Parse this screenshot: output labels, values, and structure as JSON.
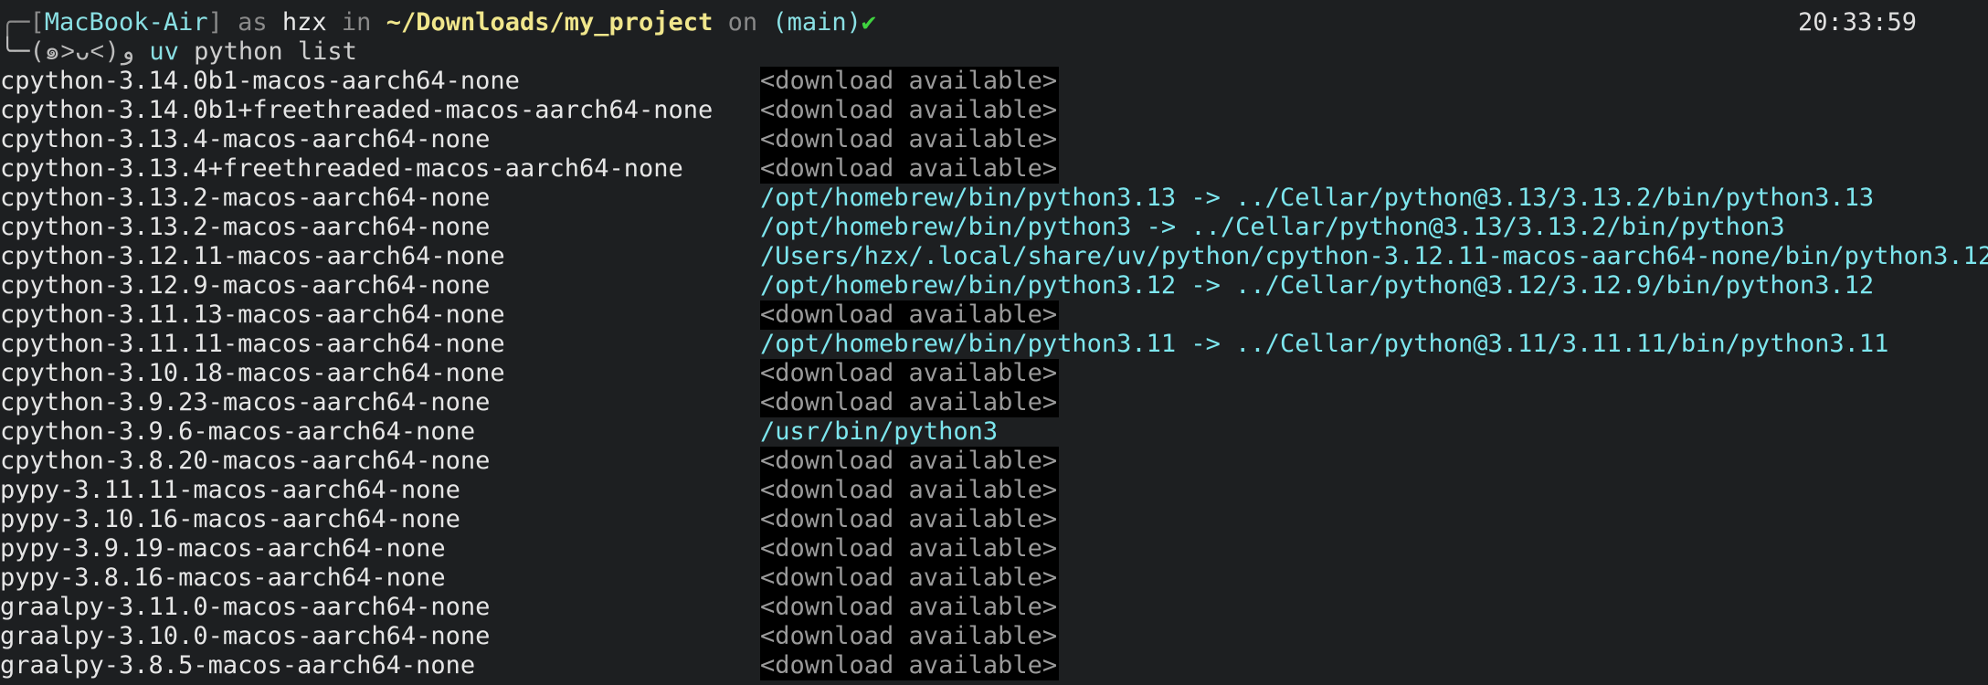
{
  "prompt": {
    "open_bracket": "╭─[",
    "host": "MacBook-Air",
    "close_bracket": "]",
    "as_word": " as ",
    "user": "hzx",
    "in_word": " in ",
    "path": "~/Downloads/my_project",
    "on_word": " on ",
    "branch": "(main)",
    "status_icon": "✔",
    "time": "20:33:59",
    "line2_prefix": "╰─(๑˃ᴗ˂)ﻭ ",
    "command_tool": "uv",
    "command_args": " python list"
  },
  "colors": {
    "background": "#1d1f21",
    "path_yellow": "#f0e68c",
    "link_cyan": "#7de6ee",
    "download_bg": "#000000",
    "check_green": "#3fd33f"
  },
  "output": [
    {
      "name": "cpython-3.14.0b1-macos-aarch64-none",
      "location": "<download available>",
      "type": "download"
    },
    {
      "name": "cpython-3.14.0b1+freethreaded-macos-aarch64-none",
      "location": "<download available>",
      "type": "download"
    },
    {
      "name": "cpython-3.13.4-macos-aarch64-none",
      "location": "<download available>",
      "type": "download"
    },
    {
      "name": "cpython-3.13.4+freethreaded-macos-aarch64-none",
      "location": "<download available>",
      "type": "download"
    },
    {
      "name": "cpython-3.13.2-macos-aarch64-none",
      "location": "/opt/homebrew/bin/python3.13 -> ../Cellar/python@3.13/3.13.2/bin/python3.13",
      "type": "path"
    },
    {
      "name": "cpython-3.13.2-macos-aarch64-none",
      "location": "/opt/homebrew/bin/python3 -> ../Cellar/python@3.13/3.13.2/bin/python3",
      "type": "path"
    },
    {
      "name": "cpython-3.12.11-macos-aarch64-none",
      "location": "/Users/hzx/.local/share/uv/python/cpython-3.12.11-macos-aarch64-none/bin/python3.12",
      "type": "path"
    },
    {
      "name": "cpython-3.12.9-macos-aarch64-none",
      "location": "/opt/homebrew/bin/python3.12 -> ../Cellar/python@3.12/3.12.9/bin/python3.12",
      "type": "path"
    },
    {
      "name": "cpython-3.11.13-macos-aarch64-none",
      "location": "<download available>",
      "type": "download"
    },
    {
      "name": "cpython-3.11.11-macos-aarch64-none",
      "location": "/opt/homebrew/bin/python3.11 -> ../Cellar/python@3.11/3.11.11/bin/python3.11",
      "type": "path"
    },
    {
      "name": "cpython-3.10.18-macos-aarch64-none",
      "location": "<download available>",
      "type": "download"
    },
    {
      "name": "cpython-3.9.23-macos-aarch64-none",
      "location": "<download available>",
      "type": "download"
    },
    {
      "name": "cpython-3.9.6-macos-aarch64-none",
      "location": "/usr/bin/python3",
      "type": "path"
    },
    {
      "name": "cpython-3.8.20-macos-aarch64-none",
      "location": "<download available>",
      "type": "download"
    },
    {
      "name": "pypy-3.11.11-macos-aarch64-none",
      "location": "<download available>",
      "type": "download"
    },
    {
      "name": "pypy-3.10.16-macos-aarch64-none",
      "location": "<download available>",
      "type": "download"
    },
    {
      "name": "pypy-3.9.19-macos-aarch64-none",
      "location": "<download available>",
      "type": "download"
    },
    {
      "name": "pypy-3.8.16-macos-aarch64-none",
      "location": "<download available>",
      "type": "download"
    },
    {
      "name": "graalpy-3.11.0-macos-aarch64-none",
      "location": "<download available>",
      "type": "download"
    },
    {
      "name": "graalpy-3.10.0-macos-aarch64-none",
      "location": "<download available>",
      "type": "download"
    },
    {
      "name": "graalpy-3.8.5-macos-aarch64-none",
      "location": "<download available>",
      "type": "download"
    }
  ]
}
